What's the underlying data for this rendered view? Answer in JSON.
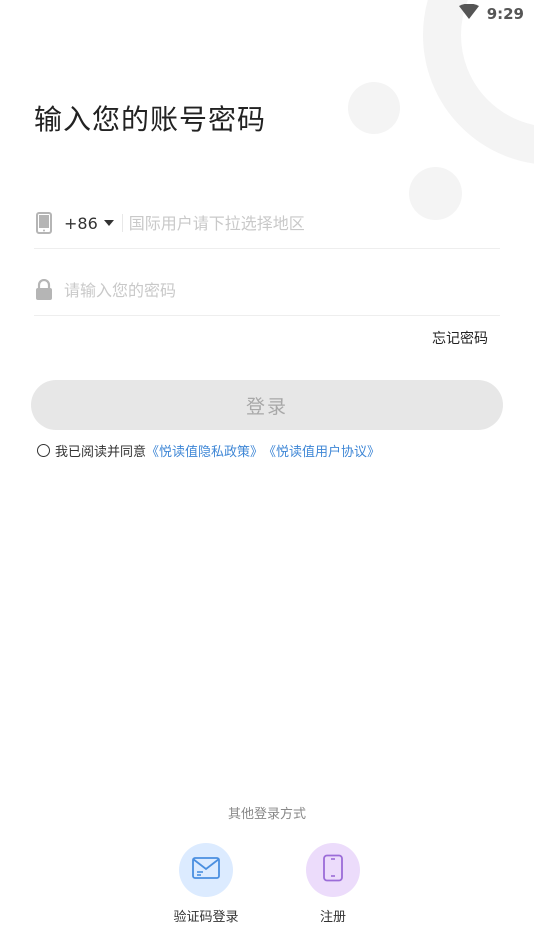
{
  "status_bar": {
    "time": "9:29"
  },
  "title": "输入您的账号密码",
  "phone": {
    "country_code": "+86",
    "value": "",
    "placeholder": "国际用户请下拉选择地区"
  },
  "password": {
    "value": "",
    "placeholder": "请输入您的密码"
  },
  "forgot_password": "忘记密码",
  "login_button": "登录",
  "agreement": {
    "prefix": "我已阅读并同意",
    "privacy_link": "《悦读值隐私政策》",
    "user_link": "《悦读值用户协议》"
  },
  "other_login": {
    "label": "其他登录方式",
    "options": [
      {
        "label": "验证码登录",
        "icon": "envelope-icon",
        "color": "#dcebff"
      },
      {
        "label": "注册",
        "icon": "phone-icon",
        "color": "#ecdcfb"
      }
    ]
  },
  "colors": {
    "link": "#3f87d6",
    "login_button_bg": "#e7e7e7"
  }
}
